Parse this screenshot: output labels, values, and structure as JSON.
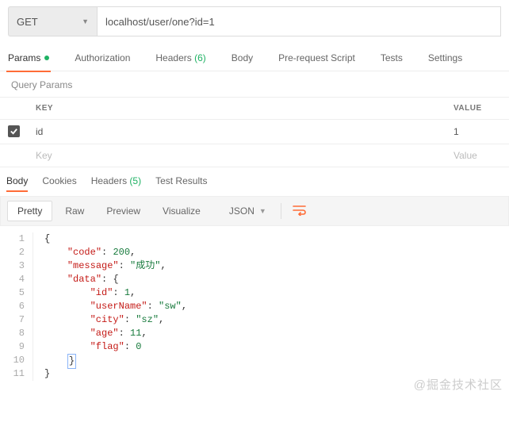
{
  "request": {
    "method": "GET",
    "url": "localhost/user/one?id=1"
  },
  "tabs": {
    "params": "Params",
    "auth": "Authorization",
    "headers_label": "Headers",
    "headers_count": "(6)",
    "body": "Body",
    "prereq": "Pre-request Script",
    "tests": "Tests",
    "settings": "Settings"
  },
  "query_section_label": "Query Params",
  "columns": {
    "key": "KEY",
    "value": "VALUE"
  },
  "rows": [
    {
      "enabled": true,
      "key": "id",
      "value": "1"
    }
  ],
  "placeholder_row": {
    "key": "Key",
    "value": "Value"
  },
  "resp_tabs": {
    "body": "Body",
    "cookies": "Cookies",
    "headers_label": "Headers",
    "headers_count": "(5)",
    "test_results": "Test Results"
  },
  "views": {
    "pretty": "Pretty",
    "raw": "Raw",
    "preview": "Preview",
    "visualize": "Visualize",
    "format": "JSON"
  },
  "response_json": {
    "code": 200,
    "message": "成功",
    "data": {
      "id": 1,
      "userName": "sw",
      "city": "sz",
      "age": 11,
      "flag": 0
    }
  },
  "watermark": "@掘金技术社区"
}
